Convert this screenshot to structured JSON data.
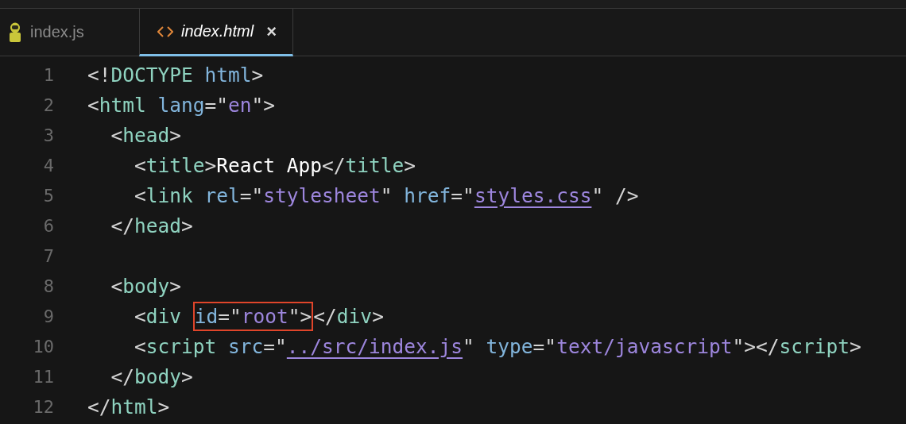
{
  "tabs": [
    {
      "label": "index.js",
      "selected": false
    },
    {
      "label": "index.html",
      "selected": true,
      "close": "×"
    }
  ],
  "lines": [
    {
      "number": "1",
      "tokens": [
        {
          "kind": "punct",
          "text": "<!"
        },
        {
          "kind": "tag",
          "text": "DOCTYPE"
        },
        {
          "kind": "attr",
          "text": " html"
        },
        {
          "kind": "punct",
          "text": ">"
        }
      ]
    },
    {
      "number": "2",
      "tokens": [
        {
          "kind": "punct",
          "text": "<"
        },
        {
          "kind": "tag",
          "text": "html"
        },
        {
          "kind": "attr",
          "text": " lang"
        },
        {
          "kind": "punct",
          "text": "=\""
        },
        {
          "kind": "string",
          "text": "en"
        },
        {
          "kind": "punct",
          "text": "\">"
        }
      ]
    },
    {
      "number": "3",
      "tokens": [
        {
          "kind": "punct",
          "text": "  <"
        },
        {
          "kind": "tag",
          "text": "head"
        },
        {
          "kind": "punct",
          "text": ">"
        }
      ]
    },
    {
      "number": "4",
      "tokens": [
        {
          "kind": "punct",
          "text": "    <"
        },
        {
          "kind": "tag",
          "text": "title"
        },
        {
          "kind": "punct",
          "text": ">"
        },
        {
          "kind": "text",
          "text": "React App"
        },
        {
          "kind": "punct",
          "text": "</"
        },
        {
          "kind": "tag",
          "text": "title"
        },
        {
          "kind": "punct",
          "text": ">"
        }
      ]
    },
    {
      "number": "5",
      "tokens": [
        {
          "kind": "punct",
          "text": "    <"
        },
        {
          "kind": "tag",
          "text": "link"
        },
        {
          "kind": "attr",
          "text": " rel"
        },
        {
          "kind": "punct",
          "text": "=\""
        },
        {
          "kind": "string",
          "text": "stylesheet"
        },
        {
          "kind": "punct",
          "text": "\" "
        },
        {
          "kind": "attr",
          "text": "href"
        },
        {
          "kind": "punct",
          "text": "=\""
        },
        {
          "kind": "link",
          "text": "styles.css"
        },
        {
          "kind": "punct",
          "text": "\" />"
        }
      ]
    },
    {
      "number": "6",
      "tokens": [
        {
          "kind": "punct",
          "text": "  </"
        },
        {
          "kind": "tag",
          "text": "head"
        },
        {
          "kind": "punct",
          "text": ">"
        }
      ]
    },
    {
      "number": "7"
    },
    {
      "number": "8",
      "tokens": [
        {
          "kind": "punct",
          "text": "  <"
        },
        {
          "kind": "tag",
          "text": "body"
        },
        {
          "kind": "punct",
          "text": ">"
        }
      ]
    },
    {
      "number": "9",
      "tokens": [
        {
          "kind": "punct",
          "text": "    <"
        },
        {
          "kind": "tag",
          "text": "div "
        },
        {
          "kind": "box",
          "tokens": [
            {
              "kind": "attr",
              "text": "id"
            },
            {
              "kind": "punct",
              "text": "=\""
            },
            {
              "kind": "string",
              "text": "root"
            },
            {
              "kind": "punct",
              "text": "\">"
            }
          ]
        },
        {
          "kind": "punct",
          "text": "</"
        },
        {
          "kind": "tag",
          "text": "div"
        },
        {
          "kind": "punct",
          "text": ">"
        }
      ]
    },
    {
      "number": "10",
      "tokens": [
        {
          "kind": "punct",
          "text": "    <"
        },
        {
          "kind": "tag",
          "text": "script"
        },
        {
          "kind": "attr",
          "text": " src"
        },
        {
          "kind": "punct",
          "text": "=\""
        },
        {
          "kind": "link",
          "text": "../src/index.js"
        },
        {
          "kind": "punct",
          "text": "\" "
        },
        {
          "kind": "attr",
          "text": "type"
        },
        {
          "kind": "punct",
          "text": "=\""
        },
        {
          "kind": "string",
          "text": "text/javascript"
        },
        {
          "kind": "punct",
          "text": "\"></"
        },
        {
          "kind": "tag",
          "text": "script"
        },
        {
          "kind": "punct",
          "text": ">"
        }
      ]
    },
    {
      "number": "11",
      "tokens": [
        {
          "kind": "punct",
          "text": "  </"
        },
        {
          "kind": "tag",
          "text": "body"
        },
        {
          "kind": "punct",
          "text": ">"
        }
      ]
    },
    {
      "number": "12",
      "tokens": [
        {
          "kind": "punct",
          "text": "</"
        },
        {
          "kind": "tag",
          "text": "html"
        },
        {
          "kind": "punct",
          "text": ">"
        }
      ]
    }
  ]
}
